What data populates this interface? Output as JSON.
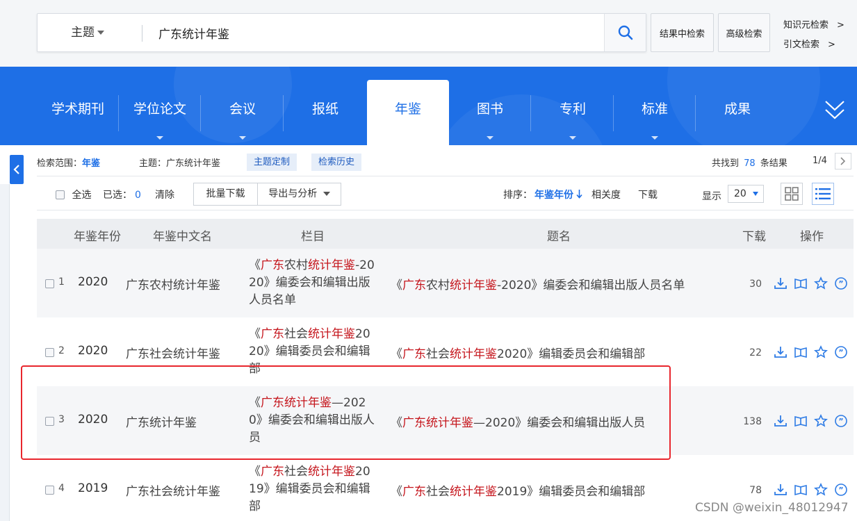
{
  "search": {
    "field": "主题",
    "query": "广东统计年鉴",
    "btn_in_results": "结果中检索",
    "btn_advanced": "高级检索",
    "link_knowledge": "知识元检索",
    "link_citation": "引文检索",
    "link_arrow": ">"
  },
  "nav": {
    "items": [
      {
        "label": "学术期刊"
      },
      {
        "label": "学位论文"
      },
      {
        "label": "会议"
      },
      {
        "label": "报纸"
      },
      {
        "label": "年鉴"
      },
      {
        "label": "图书"
      },
      {
        "label": "专利"
      },
      {
        "label": "标准"
      },
      {
        "label": "成果"
      }
    ],
    "active": "年鉴",
    "accent_color": "#1e6fe6"
  },
  "info": {
    "scope_label": "检索范围：",
    "scope_value": "年鉴",
    "topic_label": "主题：",
    "topic_value": "广东统计年鉴",
    "chip_custom": "主题定制",
    "chip_history": "检索历史",
    "found_prefix": "共找到",
    "found_count": "78",
    "found_suffix": "条结果",
    "page_indicator": "1/4",
    "next_arrow": ">"
  },
  "toolbar": {
    "select_all": "全选",
    "selected_label": "已选：",
    "selected_count": "0",
    "clear": "清除",
    "batch_download": "批量下载",
    "export": "导出与分析",
    "sort_label": "排序：",
    "sort_year": "年鉴年份",
    "sort_relevance": "相关度",
    "sort_download": "下载",
    "display_label": "显示",
    "page_size": "20"
  },
  "table": {
    "headers": [
      "年鉴年份",
      "年鉴中文名",
      "栏目",
      "题名",
      "下载",
      "操作"
    ],
    "rows": [
      {
        "num": "1",
        "year": "2020",
        "name": "广东农村统计年鉴",
        "col_lines": [
          [
            {
              "t": "《",
              "h": false
            },
            {
              "t": "广东",
              "h": true
            },
            {
              "t": "农村",
              "h": false
            },
            {
              "t": "统计年鉴",
              "h": true
            },
            {
              "t": "-20",
              "h": false
            }
          ],
          [
            {
              "t": "20》编委会和编辑出版",
              "h": false
            }
          ],
          [
            {
              "t": "人员名单",
              "h": false
            }
          ]
        ],
        "title": [
          {
            "t": "《",
            "h": false
          },
          {
            "t": "广东",
            "h": true
          },
          {
            "t": "农村",
            "h": false
          },
          {
            "t": "统计年鉴",
            "h": true
          },
          {
            "t": "-2020》编委会和编辑出版人员名单",
            "h": false
          }
        ],
        "downloads": "30"
      },
      {
        "num": "2",
        "year": "2020",
        "name": "广东社会统计年鉴",
        "col_lines": [
          [
            {
              "t": "《",
              "h": false
            },
            {
              "t": "广东",
              "h": true
            },
            {
              "t": "社会",
              "h": false
            },
            {
              "t": "统计年鉴",
              "h": true
            },
            {
              "t": "20",
              "h": false
            }
          ],
          [
            {
              "t": "20》编辑委员会和编辑",
              "h": false
            }
          ],
          [
            {
              "t": "部",
              "h": false
            }
          ]
        ],
        "title": [
          {
            "t": "《",
            "h": false
          },
          {
            "t": "广东",
            "h": true
          },
          {
            "t": "社会",
            "h": false
          },
          {
            "t": "统计年鉴",
            "h": true
          },
          {
            "t": "2020》编辑委员会和编辑部",
            "h": false
          }
        ],
        "downloads": "22"
      },
      {
        "num": "3",
        "year": "2020",
        "name": "广东统计年鉴",
        "col_lines": [
          [
            {
              "t": "《",
              "h": false
            },
            {
              "t": "广东统计年鉴",
              "h": true
            },
            {
              "t": "—202",
              "h": false
            }
          ],
          [
            {
              "t": "0》编委会和编辑出版人",
              "h": false
            }
          ],
          [
            {
              "t": "员",
              "h": false
            }
          ]
        ],
        "title": [
          {
            "t": "《",
            "h": false
          },
          {
            "t": "广东统计年鉴",
            "h": true
          },
          {
            "t": "—2020》编委会和编辑出版人员",
            "h": false
          }
        ],
        "downloads": "138"
      },
      {
        "num": "4",
        "year": "2019",
        "name": "广东社会统计年鉴",
        "col_lines": [
          [
            {
              "t": "《",
              "h": false
            },
            {
              "t": "广东",
              "h": true
            },
            {
              "t": "社会",
              "h": false
            },
            {
              "t": "统计年鉴",
              "h": true
            },
            {
              "t": "20",
              "h": false
            }
          ],
          [
            {
              "t": "19》编辑委员会和编辑",
              "h": false
            }
          ],
          [
            {
              "t": "部",
              "h": false
            }
          ]
        ],
        "title": [
          {
            "t": "《",
            "h": false
          },
          {
            "t": "广东",
            "h": true
          },
          {
            "t": "社会",
            "h": false
          },
          {
            "t": "统计年鉴",
            "h": true
          },
          {
            "t": "2019》编辑委员会和编辑部",
            "h": false
          }
        ],
        "downloads": "78"
      }
    ],
    "highlight_color": "#c5161d"
  },
  "row_icons": [
    "download-icon",
    "read-icon",
    "favorite-icon",
    "quote-icon"
  ],
  "watermark": "CSDN @weixin_48012947"
}
